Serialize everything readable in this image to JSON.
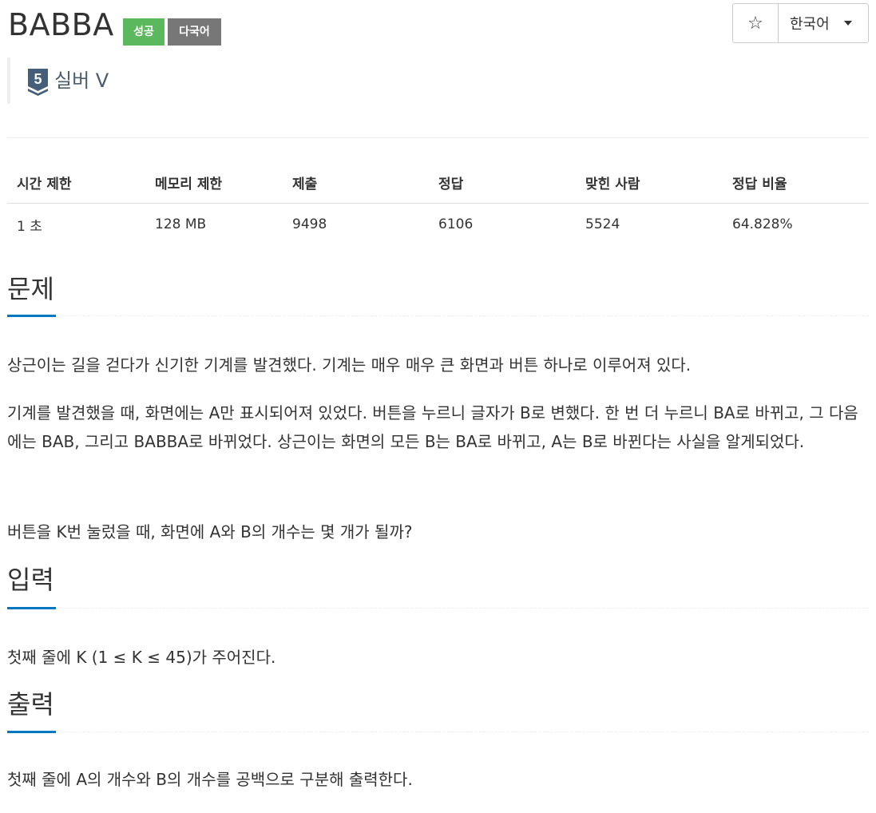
{
  "problem": {
    "title": "BABBA",
    "labels": {
      "success": "성공",
      "multilang": "다국어"
    },
    "tier": {
      "number": "5",
      "name": "실버 V"
    }
  },
  "toolbar": {
    "star_glyph": "☆",
    "language": "한국어"
  },
  "stats": {
    "headers": [
      "시간 제한",
      "메모리 제한",
      "제출",
      "정답",
      "맞힌 사람",
      "정답 비율"
    ],
    "values": [
      "1 초",
      "128 MB",
      "9498",
      "6106",
      "5524",
      "64.828%"
    ]
  },
  "sections": {
    "description": {
      "title": "문제",
      "paragraphs": [
        "상근이는 길을 걷다가 신기한 기계를 발견했다. 기계는 매우 매우 큰 화면과 버튼 하나로 이루어져 있다.",
        "기계를 발견했을 때, 화면에는 A만 표시되어져 있었다. 버튼을 누르니 글자가 B로 변했다. 한 번 더 누르니 BA로 바뀌고, 그 다음에는 BAB, 그리고 BABBA로 바뀌었다. 상근이는 화면의 모든 B는 BA로 바뀌고, A는 B로 바뀐다는 사실을 알게되었다.",
        "버튼을 K번 눌렀을 때, 화면에 A와 B의 개수는 몇 개가 될까?"
      ]
    },
    "input": {
      "title": "입력",
      "text": "첫째 줄에 K (1 ≤ K ≤ 45)가 주어진다."
    },
    "output": {
      "title": "출력",
      "text": "첫째 줄에 A의 개수와 B의 개수를 공백으로 구분해 출력한다."
    }
  },
  "colors": {
    "success": "#5cb85c",
    "multilang": "#777777",
    "accent": "#0076c0",
    "tier_silver": "#435f7a"
  }
}
